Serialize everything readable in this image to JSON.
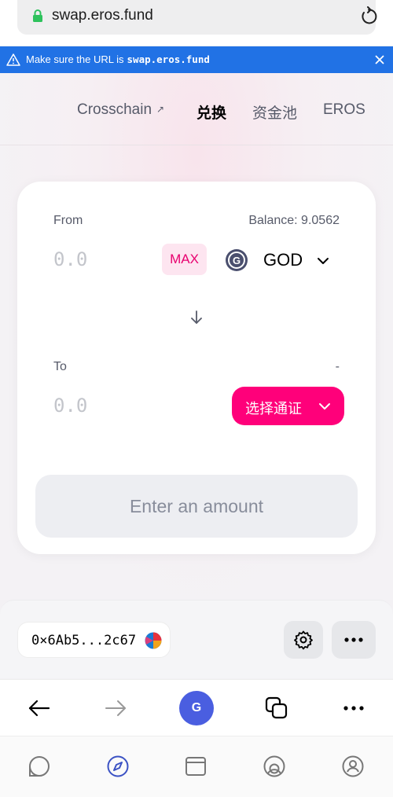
{
  "browser": {
    "url": "swap.eros.fund"
  },
  "banner": {
    "text": "Make sure the URL is",
    "url": "swap.eros.fund"
  },
  "nav": {
    "crosschain": "Crosschain",
    "crosschain_arrow": "↗",
    "swap": "兑换",
    "pool": "资金池",
    "eros": "EROS"
  },
  "swap": {
    "from_label": "From",
    "balance": "Balance: 9.0562",
    "from_placeholder": "0.0",
    "max_label": "MAX",
    "from_token": "GOD",
    "from_token_logo_letter": "G",
    "to_label": "To",
    "to_balance": "-",
    "to_placeholder": "0.0",
    "select_token_label": "选择通证",
    "submit_label": "Enter an amount"
  },
  "wallet": {
    "address": "0×6Ab5...2c67"
  },
  "browser_nav": {
    "avatar_letter": "G"
  },
  "colors": {
    "accent_pink": "#ff007a",
    "banner_blue": "#2172e5",
    "lock_green": "#2ec25c",
    "avatar_blue": "#4a5ee0"
  }
}
